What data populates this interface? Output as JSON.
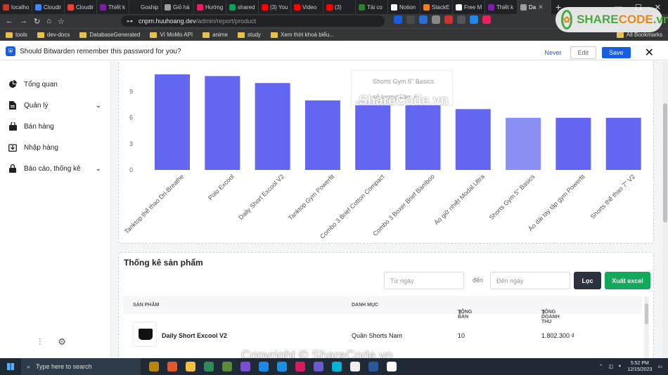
{
  "tabs": [
    {
      "label": "localho",
      "color": "#c0392b"
    },
    {
      "label": "Cloudir",
      "color": "#4285f4"
    },
    {
      "label": "Cloudir",
      "color": "#ea4335"
    },
    {
      "label": "Thiết k",
      "color": "#7b1fa2"
    },
    {
      "label": "Goship",
      "color": "#222"
    },
    {
      "label": "Giỏ hà",
      "color": "#9e9e9e"
    },
    {
      "label": "Hướng",
      "color": "#e91e63"
    },
    {
      "label": "shared",
      "color": "#0f9d58"
    },
    {
      "label": "(3) You",
      "color": "#ff0000"
    },
    {
      "label": "Video",
      "color": "#ff0000"
    },
    {
      "label": "(3)",
      "color": "#ff0000"
    },
    {
      "label": "Tải co",
      "color": "#2e7d32"
    },
    {
      "label": "Notion",
      "color": "#fff"
    },
    {
      "label": "StackE",
      "color": "#f48024"
    },
    {
      "label": "Free M",
      "color": "#fff"
    },
    {
      "label": "Thiết k",
      "color": "#7b1fa2"
    },
    {
      "label": "Da",
      "color": "#9e9e9e",
      "active": true
    }
  ],
  "url": {
    "host": "cnpm.huuhoang.dev",
    "path": "/admin/report/product"
  },
  "bookmarks": [
    "tools",
    "dev-docs",
    "DatabaseGenerated",
    "Ví MoMo API",
    "anime",
    "study",
    "Xem thời khoá biểu...",
    "All Bookmarks"
  ],
  "bitwarden": {
    "message": "Should Bitwarden remember this password for you?",
    "never": "Never",
    "edit": "Edit",
    "save": "Save"
  },
  "nav": [
    {
      "label": "Tổng quan",
      "icon": "pie-chart-icon"
    },
    {
      "label": "Quản lý",
      "icon": "document-icon",
      "chevron": true
    },
    {
      "label": "Bán hàng",
      "icon": "shopping-bag-icon"
    },
    {
      "label": "Nhập hàng",
      "icon": "inbox-download-icon"
    },
    {
      "label": "Báo cáo, thống kê",
      "icon": "lock-icon",
      "chevron": true
    }
  ],
  "chart_data": {
    "type": "bar",
    "categories": [
      "Tanktop thể thao Dri-Breathe",
      "Polo Excool",
      "Daily Short Excool V2",
      "Tanktop Gym Powerfit",
      "Combo 3 Brief Cotton Compact",
      "Combo 3 Boxer Brief Bamboo",
      "Áo giữ nhiệt Modal Ultra",
      "Shorts Gym 5\" Basics",
      "Áo dài tay tập gym Powerfit",
      "Shorts thể thao 7\" V2"
    ],
    "values": [
      11,
      10.8,
      10,
      8,
      8,
      7.5,
      7,
      6,
      6,
      6
    ],
    "highlight_index": 7,
    "colors": {
      "bar": "#6366f1",
      "highlight": "#8b8ff4"
    },
    "yticks": [
      0,
      3,
      6,
      9
    ],
    "ylim": [
      0,
      12
    ],
    "tooltip": {
      "title": "Shorts Gym 5\" Basics",
      "label": "số lượng bán",
      "value": "6"
    }
  },
  "stats": {
    "title": "Thống kê sản phẩm",
    "from_placeholder": "Từ ngày",
    "to_label": "đến",
    "to_placeholder": "Đến ngày",
    "filter": "Lọc",
    "excel": "Xuất excel",
    "columns": [
      "SẢN PHẨM",
      "DANH MỤC",
      "TỔNG BÁN",
      "TỔNG DOANH THU"
    ],
    "rows": [
      {
        "product": "Daily Short Excool V2",
        "category": "Quần Shorts Nam",
        "sold": "10",
        "revenue": "1.802.300 ₫"
      }
    ]
  },
  "watermark": {
    "name_green": "SHARE",
    "name_orange": "CODE",
    "domain": ".vn",
    "center": "ShareCode.vn",
    "copyright": "Copyright © ShareCode.vn"
  },
  "taskbar": {
    "search": "Type here to search",
    "time": "5:52 PM",
    "date": "12/15/2023"
  }
}
